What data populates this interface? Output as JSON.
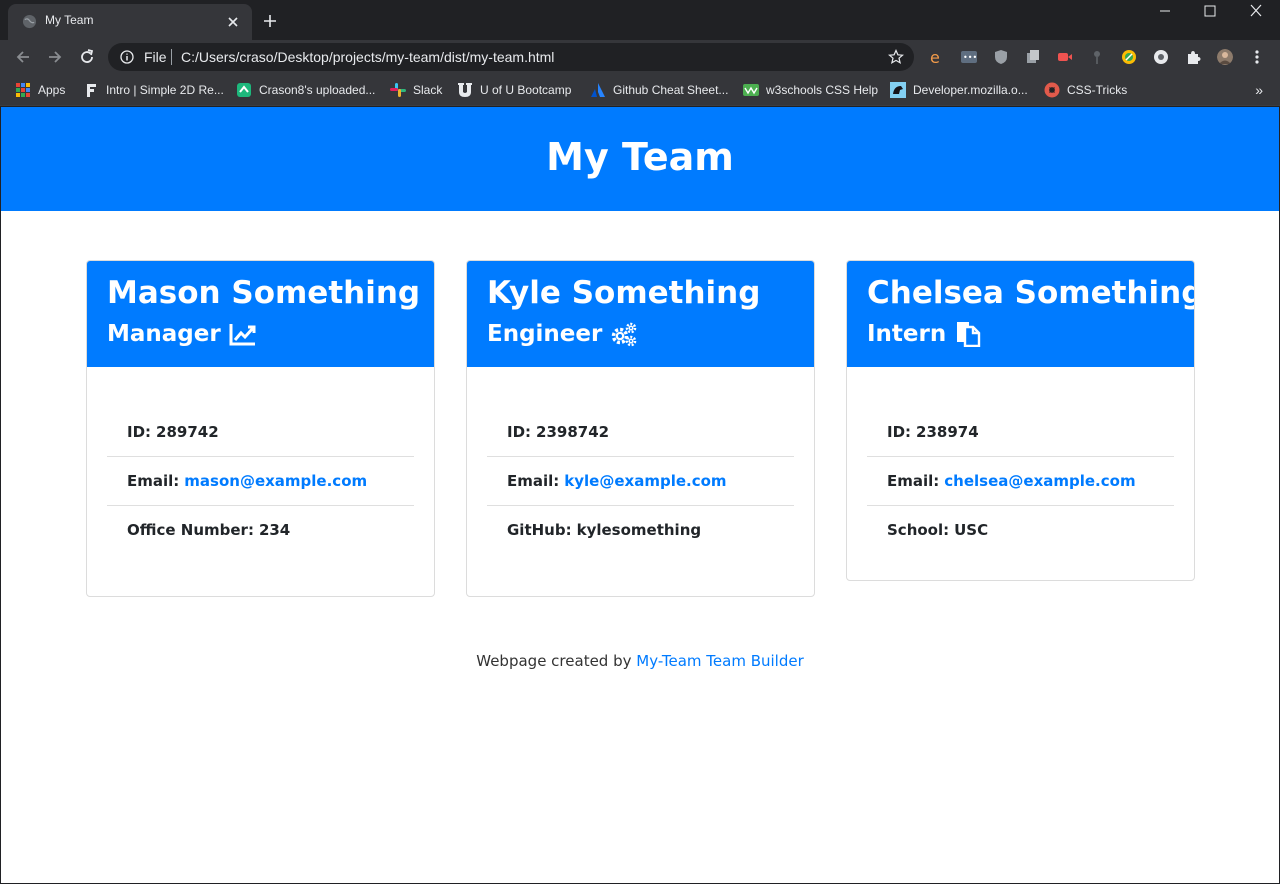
{
  "browser": {
    "tab_title": "My Team",
    "scheme": "File",
    "url": "C:/Users/craso/Desktop/projects/my-team/dist/my-team.html",
    "bookmarks": [
      {
        "label": "Apps",
        "icon": "apps-grid-icon"
      },
      {
        "label": "Intro | Simple 2D Re...",
        "icon": "f-logo-icon"
      },
      {
        "label": "Crason8's uploaded...",
        "icon": "upload-site-icon"
      },
      {
        "label": "Slack",
        "icon": "slack-icon"
      },
      {
        "label": "U of U Bootcamp",
        "icon": "u-logo-icon"
      },
      {
        "label": "Github Cheat Sheet...",
        "icon": "atlassian-icon"
      },
      {
        "label": "w3schools CSS Help",
        "icon": "w3schools-icon"
      },
      {
        "label": "Developer.mozilla.o...",
        "icon": "mdn-icon"
      },
      {
        "label": "CSS-Tricks",
        "icon": "css-tricks-icon"
      }
    ],
    "more_label": "»"
  },
  "page": {
    "title": "My Team",
    "accent_color": "#007bff",
    "members": [
      {
        "name": "Mason Something",
        "role": "Manager",
        "role_icon": "chart-line-icon",
        "id_label": "ID:",
        "id": "289742",
        "email_label": "Email:",
        "email": "mason@example.com",
        "extra_label": "Office Number:",
        "extra": "234"
      },
      {
        "name": "Kyle Something",
        "role": "Engineer",
        "role_icon": "cogs-icon",
        "id_label": "ID:",
        "id": "2398742",
        "email_label": "Email:",
        "email": "kyle@example.com",
        "extra_label": "GitHub:",
        "extra": "kylesomething"
      },
      {
        "name": "Chelsea Something",
        "role": "Intern",
        "role_icon": "copy-file-icon",
        "id_label": "ID:",
        "id": "238974",
        "email_label": "Email:",
        "email": "chelsea@example.com",
        "extra_label": "School:",
        "extra": "USC"
      }
    ],
    "footer_text": "Webpage created by",
    "footer_link": "My-Team Team Builder"
  }
}
